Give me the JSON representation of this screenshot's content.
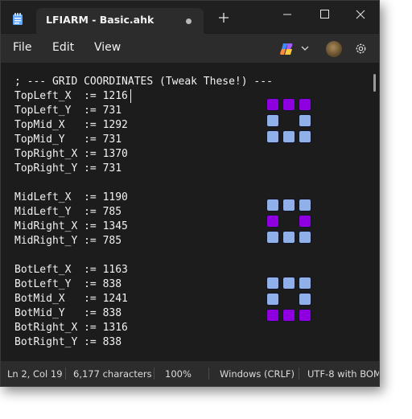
{
  "tab": {
    "title": "LFIARM - Basic.ahk"
  },
  "menu": {
    "file": "File",
    "edit": "Edit",
    "view": "View"
  },
  "icons": {
    "app": "notepad-icon",
    "new_tab": "plus-icon",
    "minimize": "minimize-icon",
    "maximize": "maximize-icon",
    "close": "close-icon",
    "copilot": "copilot-icon",
    "settings": "gear-icon"
  },
  "code": [
    "; --- GRID COORDINATES (Tweak These!) ---",
    "TopLeft_X  := 1216",
    "TopLeft_Y  := 731",
    "TopMid_X   := 1292",
    "TopMid_Y   := 731",
    "TopRight_X := 1370",
    "TopRight_Y := 731",
    "",
    "MidLeft_X  := 1190",
    "MidLeft_Y  := 785",
    "MidRight_X := 1345",
    "MidRight_Y := 785",
    "",
    "BotLeft_X  := 1163",
    "BotLeft_Y  := 838",
    "BotMid_X   := 1241",
    "BotMid_Y   := 838",
    "BotRight_X := 1316",
    "BotRight_Y := 838"
  ],
  "grid_icons": [
    {
      "name": "grid-icon-top-row",
      "highlight": [
        "purple",
        "purple",
        "purple",
        "blue",
        "empty",
        "blue",
        "blue",
        "blue",
        "blue"
      ]
    },
    {
      "name": "grid-icon-mid-row",
      "highlight": [
        "blue",
        "blue",
        "blue",
        "purple",
        "empty",
        "purple",
        "blue",
        "blue",
        "blue"
      ]
    },
    {
      "name": "grid-icon-bottom-row",
      "highlight": [
        "blue",
        "blue",
        "blue",
        "blue",
        "empty",
        "blue",
        "purple",
        "purple",
        "purple"
      ]
    }
  ],
  "colors": {
    "purple": "#8e00e0",
    "blue": "#8fb0e8",
    "window_bg": "#1c1c1c",
    "chrome_bg": "#2c2c2c"
  },
  "status": {
    "position": "Ln 2, Col 19",
    "characters": "6,177 characters",
    "zoom": "100%",
    "line_ending": "Windows (CRLF)",
    "encoding": "UTF-8 with BOM"
  }
}
